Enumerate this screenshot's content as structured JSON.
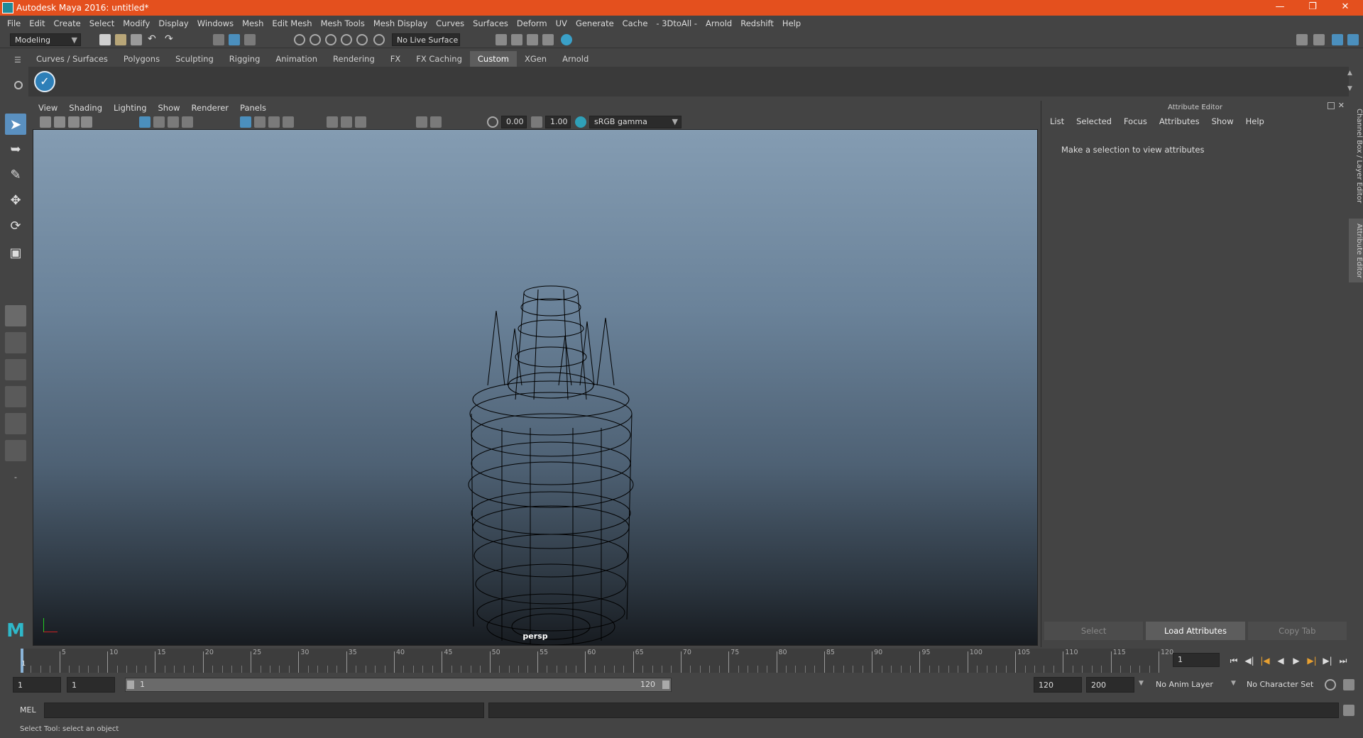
{
  "window": {
    "title": "Autodesk Maya 2016: untitled*"
  },
  "menubar": [
    "File",
    "Edit",
    "Create",
    "Select",
    "Modify",
    "Display",
    "Windows",
    "Mesh",
    "Edit Mesh",
    "Mesh Tools",
    "Mesh Display",
    "Curves",
    "Surfaces",
    "Deform",
    "UV",
    "Generate",
    "Cache",
    "- 3DtoAll -",
    "Arnold",
    "Redshift",
    "Help"
  ],
  "statusline": {
    "mode": "Modeling",
    "live_surface": "No Live Surface"
  },
  "shelf": {
    "tabs": [
      "Curves / Surfaces",
      "Polygons",
      "Sculpting",
      "Rigging",
      "Animation",
      "Rendering",
      "FX",
      "FX Caching",
      "Custom",
      "XGen",
      "Arnold"
    ],
    "active_tab": "Custom"
  },
  "viewport": {
    "menu": [
      "View",
      "Shading",
      "Lighting",
      "Show",
      "Renderer",
      "Panels"
    ],
    "exposure": "0.00",
    "gamma": "1.00",
    "color_space": "sRGB gamma",
    "camera": "persp"
  },
  "attribute_editor": {
    "title": "Attribute Editor",
    "menu": [
      "List",
      "Selected",
      "Focus",
      "Attributes",
      "Show",
      "Help"
    ],
    "message": "Make a selection to view attributes",
    "buttons": [
      "Select",
      "Load Attributes",
      "Copy Tab"
    ]
  },
  "side_tabs": [
    "Channel Box / Layer Editor",
    "Attribute Editor"
  ],
  "timeline": {
    "tick_labels": [
      "5",
      "10",
      "15",
      "20",
      "25",
      "30",
      "35",
      "40",
      "45",
      "50",
      "55",
      "60",
      "65",
      "70",
      "75",
      "80",
      "85",
      "90",
      "95",
      "100",
      "105",
      "110",
      "115",
      "120"
    ],
    "current_frame_marker": "1",
    "current_frame": "1"
  },
  "range": {
    "start": "1",
    "playback_start": "1",
    "slider_start": "1",
    "slider_end": "120",
    "playback_end": "120",
    "end": "200",
    "anim_layer": "No Anim Layer",
    "character_set": "No Character Set"
  },
  "command_line": {
    "lang": "MEL"
  },
  "help_line": "Select Tool: select an object"
}
